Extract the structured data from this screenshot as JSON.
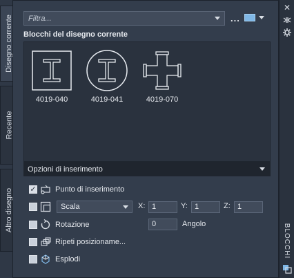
{
  "tabs": {
    "current": "Disegno corrente",
    "recent": "Recente",
    "other": "Altro disegno"
  },
  "right_strip": {
    "title": "BLOCCHI",
    "close_icon": "close-icon",
    "autohide_icon": "autohide-icon",
    "settings_icon": "settings-icon"
  },
  "toolbar": {
    "filter_placeholder": "Filtra...",
    "more_label": "..."
  },
  "section_title": "Blocchi del disegno corrente",
  "blocks": [
    {
      "label": "4019-040",
      "icon": "i-beam-square-icon"
    },
    {
      "label": "4019-041",
      "icon": "i-beam-circle-icon"
    },
    {
      "label": "4019-070",
      "icon": "cross-fitting-icon"
    }
  ],
  "insert_options": {
    "header": "Opzioni di inserimento",
    "insertion_point": {
      "label": "Punto di inserimento",
      "checked": true
    },
    "scale": {
      "checked": false,
      "mode": "Scala",
      "x_label": "X:",
      "x": "1",
      "y_label": "Y:",
      "y": "1",
      "z_label": "Z:",
      "z": "1"
    },
    "rotation": {
      "label": "Rotazione",
      "checked": false,
      "value": "0",
      "unit_label": "Angolo"
    },
    "repeat": {
      "label": "Ripeti posizioname...",
      "checked": false
    },
    "explode": {
      "label": "Esplodi",
      "checked": false
    }
  },
  "colors": {
    "panel_bg": "#333d4c",
    "list_bg": "#2a323e",
    "header_bg": "#1f252e",
    "accent": "#7fb7e6"
  }
}
